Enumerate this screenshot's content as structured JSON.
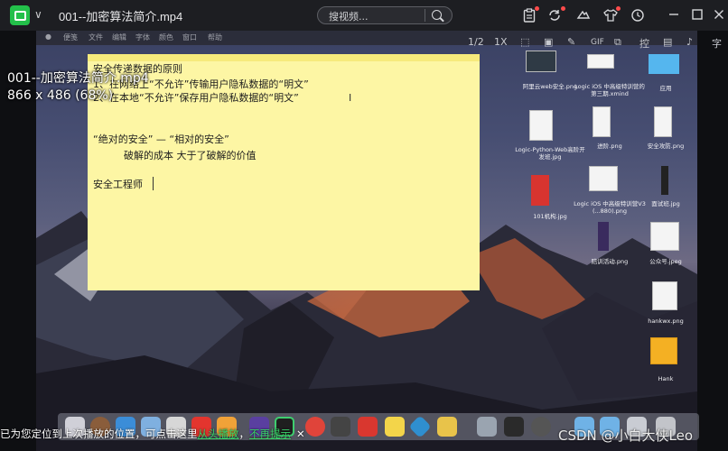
{
  "titlebar": {
    "title": "001--加密算法简介.mp4",
    "search_placeholder": "搜视频..."
  },
  "overlay": {
    "video_title": "001--加密算法简介.mp4",
    "video_size": "866 x 486 (68%)",
    "toolbar": [
      "1/2",
      "1X",
      "GIF",
      "控",
      "字"
    ]
  },
  "mac_menubar": [
    "文件",
    "编辑",
    "字体",
    "颜色",
    "窗口",
    "帮助"
  ],
  "sticky_note": {
    "lines": [
      "安全传递数据的原则",
      "1、在网络上“不允许”传输用户隐私数据的“明文”",
      "2、在本地“不允许”保存用户隐私数据的“明文”",
      "“绝对的安全” — “相对的安全”",
      "破解的成本 大于了破解的价值",
      "安全工程师"
    ]
  },
  "desktop_icons": [
    {
      "label": "阿里云web安全.png"
    },
    {
      "label": "Logic iOS 中高级特训营的第三期.xmind"
    },
    {
      "label": "应用"
    },
    {
      "label": "Logic-Python-Web高阶开发班.jpg"
    },
    {
      "label": "进阶.png"
    },
    {
      "label": "安全攻防.png"
    },
    {
      "label": "101机构.jpg"
    },
    {
      "label": "Logic iOS 中高级特训营V3 (...880).png"
    },
    {
      "label": "面试班.jpg"
    },
    {
      "label": "陪训活动.png"
    },
    {
      "label": "公众号.jpeg"
    },
    {
      "label": "hankwx.png"
    },
    {
      "label": "Hank"
    }
  ],
  "resume_bar": {
    "text": "已为您定位到上次播放的位置，可点击这里",
    "link1": "从头播放",
    "sep": "，",
    "link2": "不再提示",
    "close": "✕"
  },
  "watermark": "CSDN @小白大侠Leo",
  "colors": {
    "note_bg": "#fdf6a4",
    "app_logo": "#23c04a",
    "link_green": "#3bd46a"
  }
}
